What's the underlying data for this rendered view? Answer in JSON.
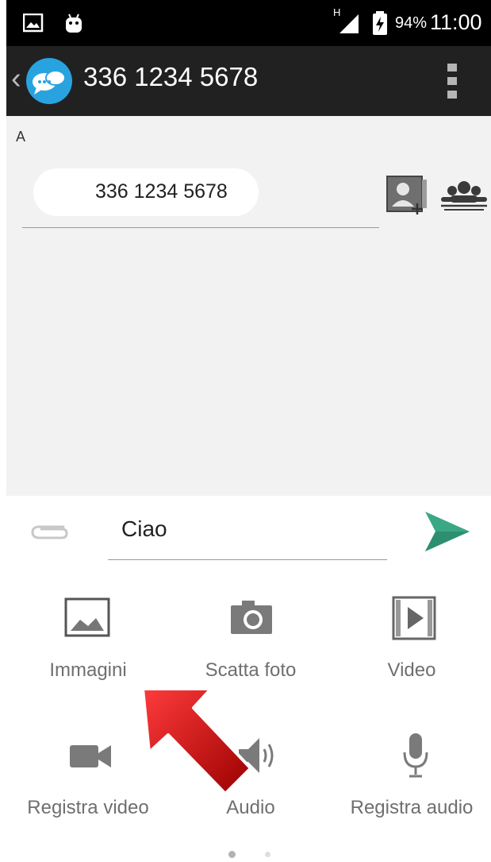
{
  "status_bar": {
    "battery": "94%",
    "time": "11:00",
    "network_type": "H"
  },
  "app_bar": {
    "title": "336 1234 5678",
    "back_glyph": "‹"
  },
  "recipients": {
    "to_label": "A",
    "chip": "336 1234 5678"
  },
  "compose": {
    "message": "Ciao"
  },
  "attachments": [
    {
      "label": "Immagini",
      "icon": "image-icon"
    },
    {
      "label": "Scatta foto",
      "icon": "camera-icon"
    },
    {
      "label": "Video",
      "icon": "video-file-icon"
    },
    {
      "label": "Registra video",
      "icon": "video-camera-icon"
    },
    {
      "label": "Audio",
      "icon": "audio-icon"
    },
    {
      "label": "Registra audio",
      "icon": "microphone-icon"
    }
  ],
  "pager": {
    "current": 1,
    "total": 2
  },
  "colors": {
    "app_bar": "#212121",
    "status_bar": "#000000",
    "recipient_bg": "#f2f2f2",
    "send_accent": "#3aa884",
    "app_icon": "#29a3e0",
    "arrow": "#c90000"
  }
}
